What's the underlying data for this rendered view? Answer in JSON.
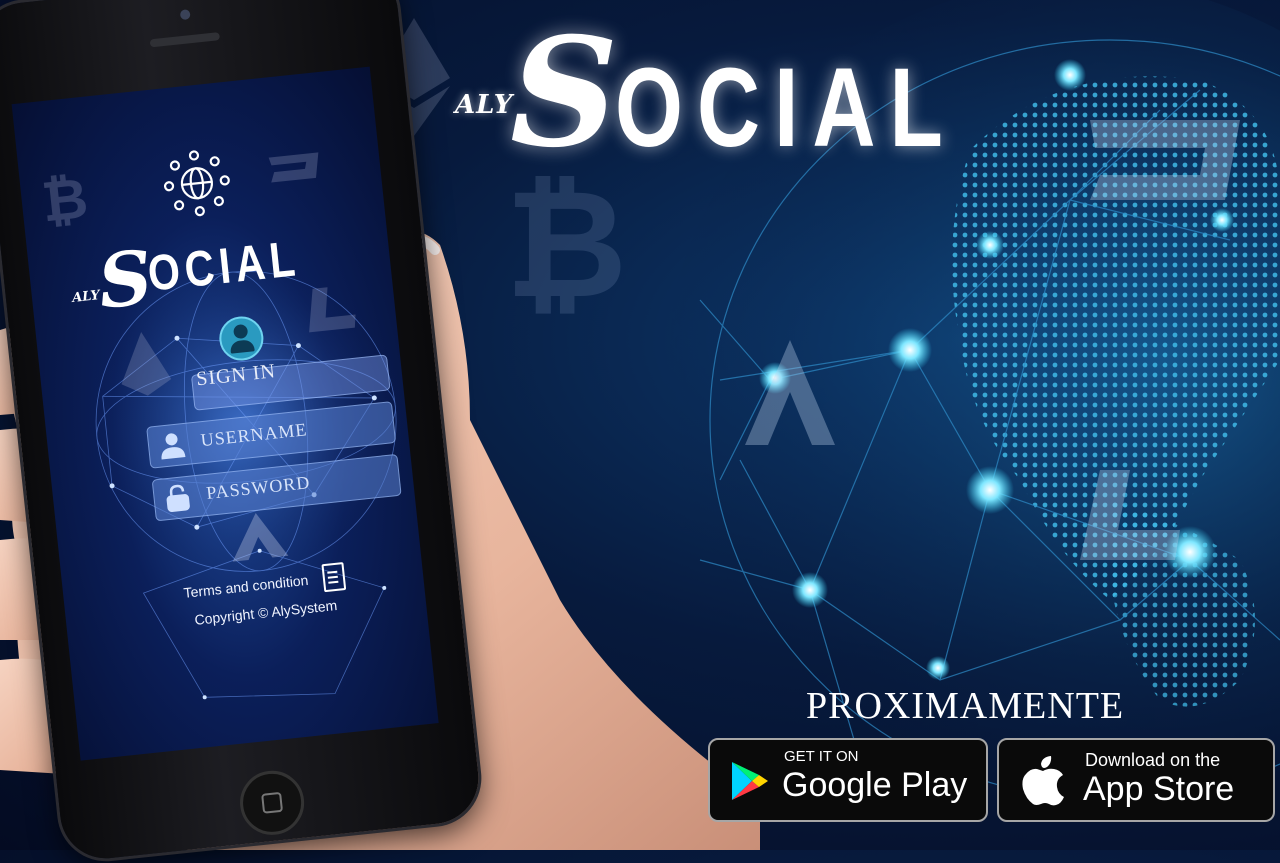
{
  "logo": {
    "prefix": "ALY",
    "initial": "S",
    "rest": "OCIAL"
  },
  "phone": {
    "logo": {
      "prefix": "ALY",
      "initial": "S",
      "rest": "OCIAL"
    },
    "signin": "SIGN IN",
    "username_placeholder": "USERNAME",
    "password_placeholder": "PASSWORD",
    "terms": "Terms and condition",
    "copyright": "Copyright © AlySystem"
  },
  "promo": {
    "coming_soon": "PROXIMAMENTE",
    "google_play": {
      "small": "GET IT ON",
      "large": "Google Play"
    },
    "app_store": {
      "small": "Download on the",
      "large": "App Store"
    }
  },
  "colors": {
    "background": "#071a3d",
    "accent": "#35d8ff",
    "badge": "#0a0a0a"
  },
  "icons": [
    "ethereum-icon",
    "bitcoin-icon",
    "dash-icon",
    "litecoin-icon",
    "globe-network-icon",
    "user-icon",
    "lock-icon",
    "document-icon",
    "google-play-icon",
    "apple-icon"
  ]
}
